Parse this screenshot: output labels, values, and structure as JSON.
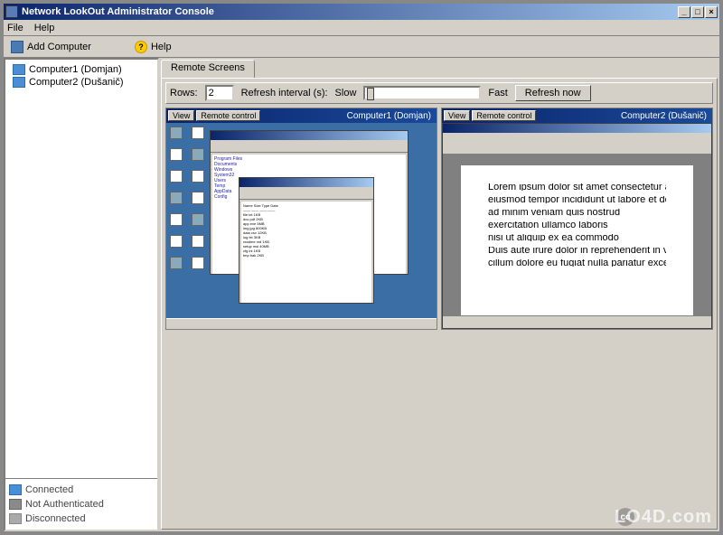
{
  "window": {
    "title": "Network LookOut Administrator Console",
    "min": "_",
    "max": "□",
    "close": "×"
  },
  "menu": {
    "file": "File",
    "help": "Help"
  },
  "toolbar": {
    "add_computer": "Add Computer",
    "help": "Help"
  },
  "sidebar": {
    "items": [
      {
        "label": "Computer1 (Domjan)"
      },
      {
        "label": "Computer2 (Dušanič)"
      }
    ],
    "legend": {
      "connected": "Connected",
      "not_authenticated": "Not Authenticated",
      "disconnected": "Disconnected"
    }
  },
  "tabs": {
    "remote": "Remote Screens"
  },
  "controls": {
    "rows_label": "Rows:",
    "rows_value": "2",
    "refresh_label": "Refresh interval (s):",
    "slow": "Slow",
    "fast": "Fast",
    "refresh_btn": "Refresh now"
  },
  "screens": [
    {
      "view_btn": "View",
      "control_btn": "Remote control",
      "title": "Computer1 (Domjan)"
    },
    {
      "view_btn": "View",
      "control_btn": "Remote control",
      "title": "Computer2 (Dušanič)"
    }
  ],
  "watermark": "LO4D.com",
  "cc": "cc"
}
